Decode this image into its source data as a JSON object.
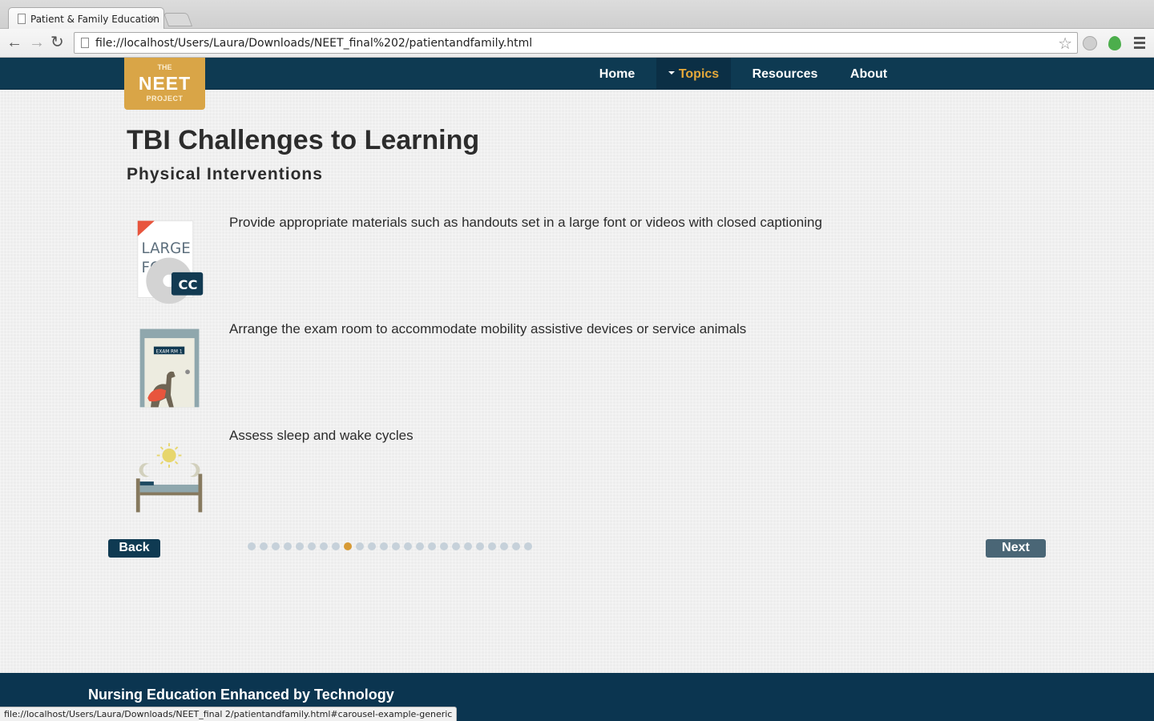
{
  "browser": {
    "tab_title": "Patient & Family Education",
    "tab_close": "×",
    "url": "file://localhost/Users/Laura/Downloads/NEET_final%202/patientandfamily.html",
    "back_icon": "←",
    "forward_icon": "→",
    "reload_icon": "↻",
    "star_icon": "☆",
    "status_url": "file://localhost/Users/Laura/Downloads/NEET_final 2/patientandfamily.html#carousel-example-generic"
  },
  "logo": {
    "line1": "THE",
    "line2": "NEET",
    "line3": "PROJECT"
  },
  "nav": {
    "items": [
      {
        "label": "Home"
      },
      {
        "label": "Topics",
        "active": true
      },
      {
        "label": "Resources"
      },
      {
        "label": "About"
      }
    ]
  },
  "page": {
    "title": "TBI Challenges to Learning",
    "subtitle": "Physical Interventions"
  },
  "interventions": [
    {
      "text": "Provide appropriate materials such as handouts set in a large font or videos with closed captioning",
      "illus_text_1": "LARGE",
      "illus_text_2": "FO",
      "illus_badge": "CC"
    },
    {
      "text": "Arrange the exam room to accommodate mobility assistive devices or service animals",
      "illus_sign": "EXAM RM 1"
    },
    {
      "text": "Assess sleep and wake cycles"
    }
  ],
  "carousel": {
    "back_label": "Back",
    "next_label": "Next",
    "total_slides": 24,
    "current_slide": 9
  },
  "footer": {
    "text": "Nursing Education Enhanced by Technology"
  },
  "colors": {
    "nav_bg": "#0e3a52",
    "accent": "#d9a547",
    "active_nav_text": "#e6a93a"
  }
}
